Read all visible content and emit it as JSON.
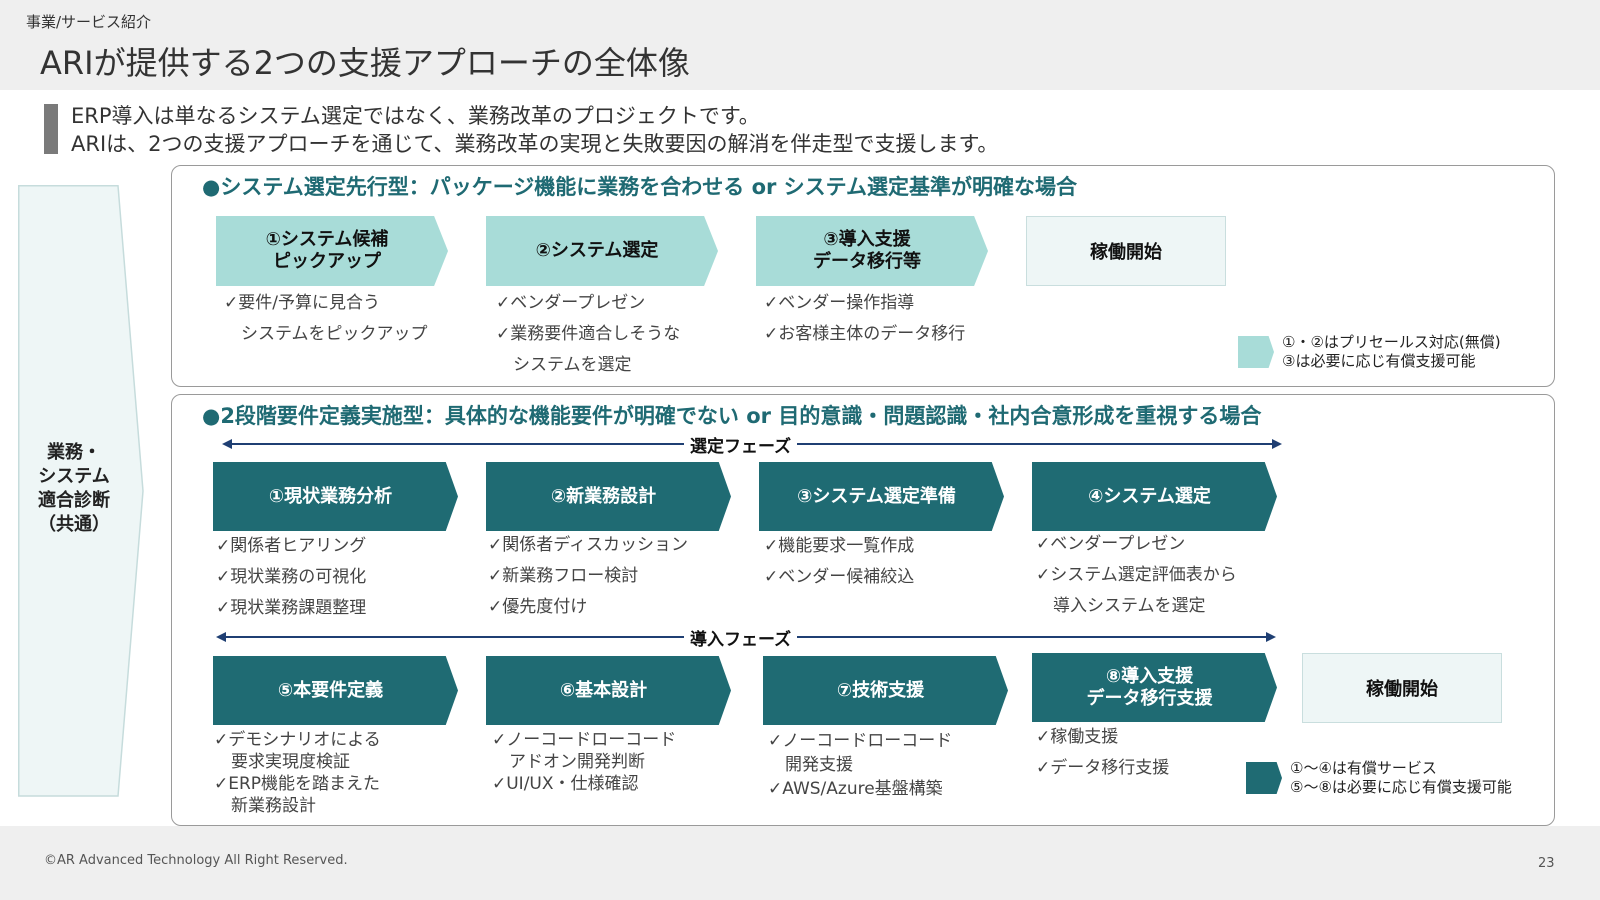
{
  "header": {
    "breadcrumb": "事業/サービス紹介",
    "title": "ARIが提供する2つの支援アプローチの全体像"
  },
  "lead": {
    "line1": "ERP導入は単なるシステム選定ではなく、業務改革のプロジェクトです。",
    "line2": "ARIは、2つの支援アプローチを通じて、業務改革の実現と失敗要因の解消を伴走型で支援します。"
  },
  "diagnosis": {
    "label": "業務・\nシステム\n適合診断\n（共通）"
  },
  "panel1": {
    "heading": "●システム選定先行型：パッケージ機能に業務を合わせる or システム選定基準が明確な場合",
    "steps": [
      {
        "label": "①システム候補\nピックアップ",
        "items": [
          "✓要件/予算に見合う",
          "　システムをピックアップ"
        ]
      },
      {
        "label": "②システム選定",
        "items": [
          "✓ベンダープレゼン",
          "✓業務要件適合しそうな",
          "　システムを選定"
        ]
      },
      {
        "label": "③導入支援\nデータ移行等",
        "items": [
          "✓ベンダー操作指導",
          "✓お客様主体のデータ移行"
        ]
      }
    ],
    "start_label": "稼働開始",
    "legend": [
      "①・②はプリセールス対応(無償)",
      "③は必要に応じ有償支援可能"
    ]
  },
  "panel2": {
    "heading": "●2段階要件定義実施型：具体的な機能要件が明確でない or 目的意識・問題認識・社内合意形成を重視する場合",
    "phase1_label": "選定フェーズ",
    "phase2_label": "導入フェーズ",
    "row1": [
      {
        "label": "①現状業務分析",
        "items": [
          "✓関係者ヒアリング",
          "✓現状業務の可視化",
          "✓現状業務課題整理"
        ]
      },
      {
        "label": "②新業務設計",
        "items": [
          "✓関係者ディスカッション",
          "✓新業務フロー検討",
          "✓優先度付け"
        ]
      },
      {
        "label": "③システム選定準備",
        "items": [
          "✓機能要求一覧作成",
          "✓ベンダー候補絞込"
        ]
      },
      {
        "label": "④システム選定",
        "items": [
          "✓ベンダープレゼン",
          "✓システム選定評価表から",
          "　導入システムを選定"
        ]
      }
    ],
    "row2": [
      {
        "label": "⑤本要件定義",
        "items": [
          "✓デモシナリオによる",
          "　要求実現度検証",
          "✓ERP機能を踏まえた",
          "　新業務設計"
        ]
      },
      {
        "label": "⑥基本設計",
        "items": [
          "✓ノーコードローコード",
          "　アドオン開発判断",
          "✓UI/UX・仕様確認"
        ]
      },
      {
        "label": "⑦技術支援",
        "items": [
          "✓ノーコードローコード",
          "　開発支援",
          "✓AWS/Azure基盤構築"
        ]
      },
      {
        "label": "⑧導入支援\nデータ移行支援",
        "items": [
          "✓稼働支援",
          "✓データ移行支援"
        ]
      }
    ],
    "start_label": "稼働開始",
    "legend": [
      "①〜④は有償サービス",
      "⑤〜⑧は必要に応じ有償支援可能"
    ]
  },
  "footer": {
    "copyright": "©AR Advanced Technology All Right Reserved.",
    "page": "23"
  },
  "colors": {
    "teal_dark": "#1f6b73",
    "teal_light": "#a8dcd8",
    "heading_teal": "#1f6a73",
    "arrow_navy": "#1f3f73"
  }
}
